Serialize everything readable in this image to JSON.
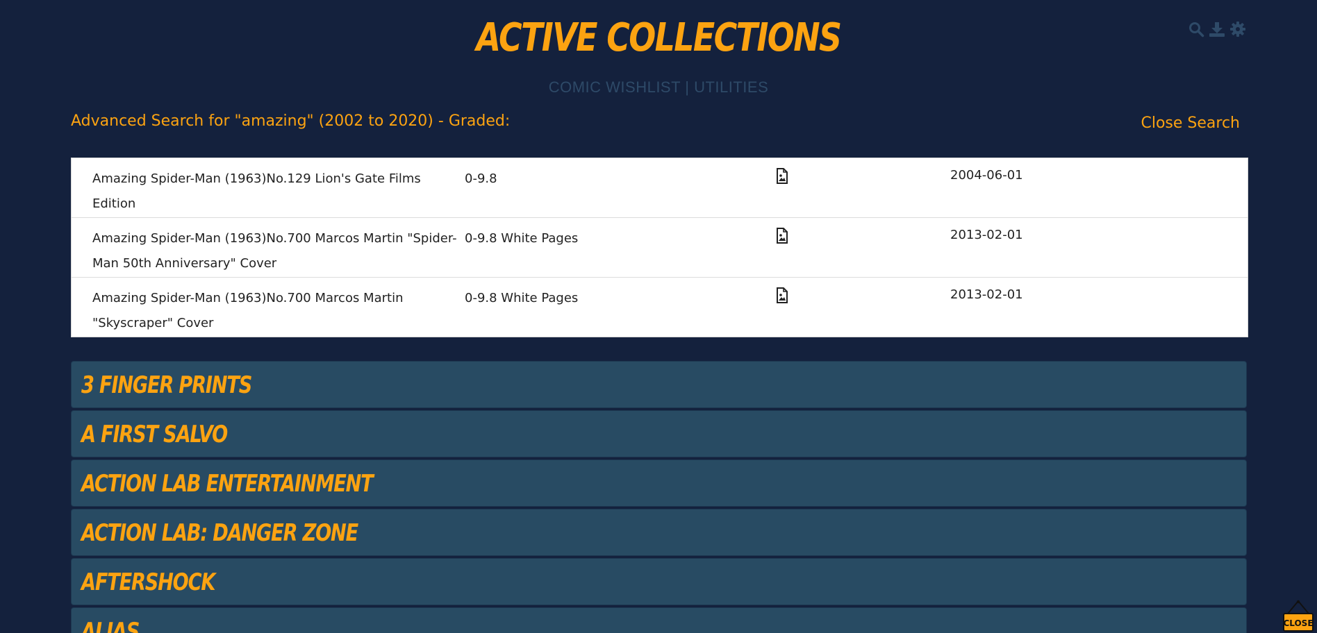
{
  "header": {
    "title": "Active Collections",
    "nav": "COMIC WISHLIST | UTILITIES",
    "icons": [
      "search-icon",
      "download-icon",
      "gear-icon"
    ]
  },
  "search": {
    "heading": "Advanced Search for \"amazing\" (2002 to 2020) - Graded:",
    "close_label": "Close Search"
  },
  "results": [
    {
      "title": "Amazing Spider-Man (1963)No.129 Lion's Gate Films Edition",
      "grade": "0-9.8",
      "icon": "image-file-icon",
      "date": "2004-06-01"
    },
    {
      "title": "Amazing Spider-Man (1963)No.700 Marcos Martin \"Spider-Man 50th Anniversary\" Cover",
      "grade": "0-9.8 White Pages",
      "icon": "image-file-icon",
      "date": "2013-02-01"
    },
    {
      "title": "Amazing Spider-Man (1963)No.700 Marcos Martin \"Skyscraper\" Cover",
      "grade": "0-9.8 White Pages",
      "icon": "image-file-icon",
      "date": "2013-02-01"
    }
  ],
  "collections": [
    "3 Finger Prints",
    "A First Salvo",
    "Action Lab Entertainment",
    "Action Lab: Danger Zone",
    "Aftershock",
    "Alias"
  ],
  "close_badge": {
    "label": "CLOSE"
  },
  "colors": {
    "background": "#14213d",
    "accent": "#fca311",
    "panel": "#284b63",
    "nav_text": "#2e4a68"
  }
}
